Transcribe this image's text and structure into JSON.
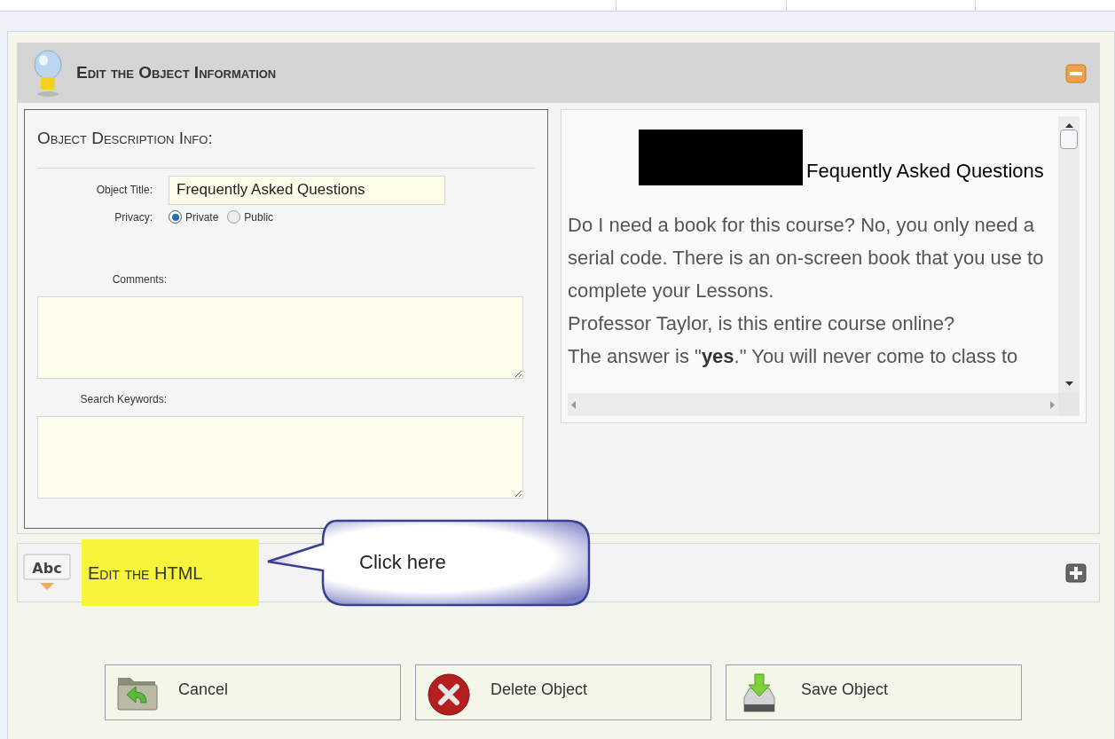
{
  "header": {
    "title": "Edit the Object Information",
    "expanded": true
  },
  "description": {
    "heading": "Object Description Info:",
    "title_label": "Object Title:",
    "title_value": "Frequently Asked Questions",
    "privacy_label": "Privacy:",
    "privacy_options": [
      {
        "label": "Private",
        "selected": true
      },
      {
        "label": "Public",
        "selected": false
      }
    ],
    "comments_label": "Comments:",
    "keywords_label": "Search Keywords:"
  },
  "preview": {
    "title": "Fequently Asked Questions",
    "paragraphs": [
      "Do I need a book for this course? No, you only need a serial code. There is an on-screen book that you use to complete your Lessons.",
      "Professor Taylor, is this entire course online?",
      "The answer is \"**yes**.\" You will never come to class to"
    ]
  },
  "html_section": {
    "title": "Edit the HTML",
    "icon_text": "Abc",
    "expanded": false,
    "highlighted": true
  },
  "callout": {
    "text": "Click here"
  },
  "buttons": [
    {
      "label": "Cancel",
      "kind": "cancel"
    },
    {
      "label": "Delete Object",
      "kind": "delete"
    },
    {
      "label": "Save Object",
      "kind": "save"
    }
  ]
}
